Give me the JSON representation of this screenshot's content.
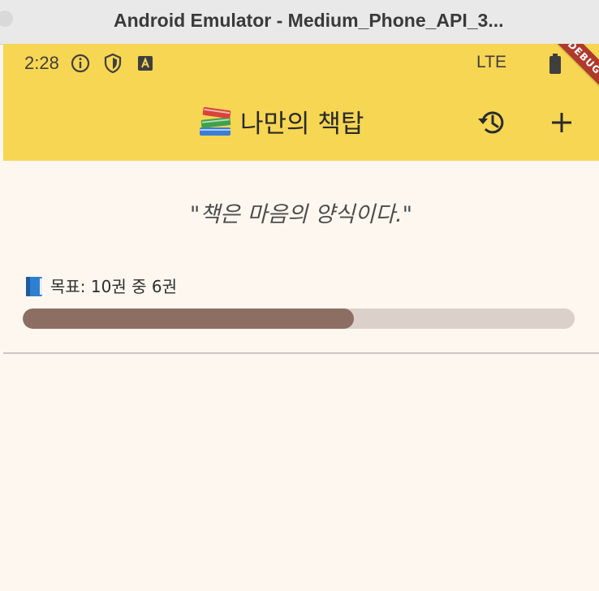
{
  "window": {
    "title": "Android Emulator - Medium_Phone_API_3..."
  },
  "status_bar": {
    "time": "2:28",
    "network": "LTE",
    "icons": [
      "info-icon",
      "shield-icon",
      "a-box-icon",
      "battery-icon"
    ]
  },
  "debug_banner": "DEBUG",
  "app_bar": {
    "title": "나만의 책탑",
    "title_icon": "books-emoji",
    "actions": [
      "history-icon",
      "add-icon"
    ]
  },
  "quote": "\"책은 마음의 양식이다.\"",
  "goal": {
    "icon": "blue-book-emoji",
    "text": "목표: 10권 중 6권",
    "target": 10,
    "current": 6,
    "progress": 0.6
  },
  "colors": {
    "app_bar": "#f7d653",
    "background": "#fdf7f0",
    "progress_fill": "#8d6e63",
    "progress_track": "#dcd0cb",
    "debug_ribbon": "#b0392c"
  }
}
